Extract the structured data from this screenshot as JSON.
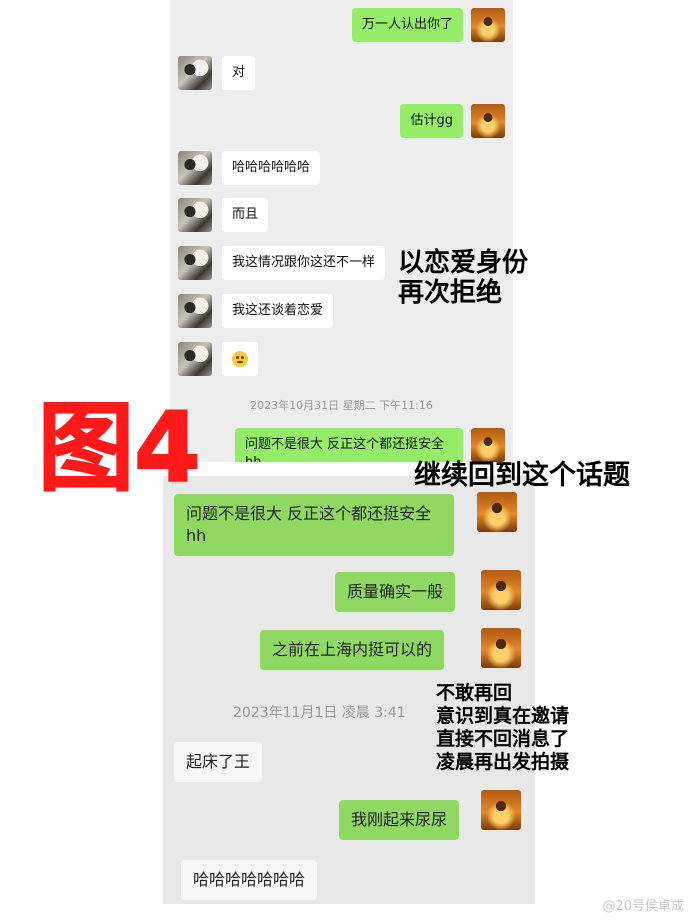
{
  "top_chat": {
    "messages": [
      {
        "side": "right",
        "text": "万一人认出你了"
      },
      {
        "side": "left",
        "text": "对"
      },
      {
        "side": "right",
        "text": "估计gg"
      },
      {
        "side": "left",
        "text": "哈哈哈哈哈哈"
      },
      {
        "side": "left",
        "text": "而且"
      },
      {
        "side": "left",
        "text": "我这情况跟你这还不一样"
      },
      {
        "side": "left",
        "text": "我这还谈着恋爱"
      },
      {
        "side": "left",
        "text": "",
        "emoji": "slight-smile-emoji"
      }
    ],
    "timestamp": "2023年10月31日 星期二 下午11:16",
    "last_message": "问题不是很大 反正这个都还挺安全hh"
  },
  "bottom_chat": {
    "messages": [
      {
        "side": "right",
        "text": "问题不是很大 反正这个都还挺安全hh"
      },
      {
        "side": "right",
        "text": "质量确实一般"
      },
      {
        "side": "right",
        "text": "之前在上海内挺可以的"
      }
    ],
    "timestamp": "2023年11月1日 凌晨 3:41",
    "messages_after": [
      {
        "side": "left",
        "text": "起床了王"
      },
      {
        "side": "right",
        "text": "我刚起来尿尿"
      },
      {
        "side": "left",
        "text": "哈哈哈哈哈哈哈"
      }
    ]
  },
  "annotations": {
    "figure_label": "图4",
    "note1_line1": "以恋爱身份",
    "note1_line2": "再次拒绝",
    "note2": "继续回到这个话题",
    "note3_line1": "不敢再回",
    "note3_line2": "意识到真在邀请",
    "note3_line3": "直接不回消息了",
    "note3_line4": "凌晨再出发拍摄"
  },
  "watermark": "@20号侯卓成",
  "colors": {
    "green_bubble": "#95ec69",
    "figure_label": "#ff1a1a"
  }
}
